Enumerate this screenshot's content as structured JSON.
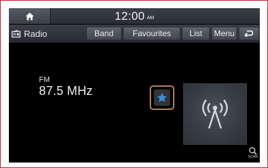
{
  "status_bar": {
    "time": "12:00",
    "ampm": "AM"
  },
  "toolbar": {
    "source_label": "Radio",
    "band_label": "Band",
    "favourites_label": "Favourites",
    "list_label": "List",
    "menu_label": "Menu"
  },
  "station": {
    "band": "FM",
    "frequency": "87.5 MHz",
    "favourite": true
  },
  "scan": {
    "label": "SCAN"
  },
  "colors": {
    "highlight_outline": "#b5834f",
    "star": "#3d8fe0",
    "frame_border": "#c41e2b"
  },
  "icons": [
    "home-icon",
    "radio-icon",
    "back-icon",
    "star-icon",
    "broadcast-antenna-icon",
    "scan-icon"
  ]
}
